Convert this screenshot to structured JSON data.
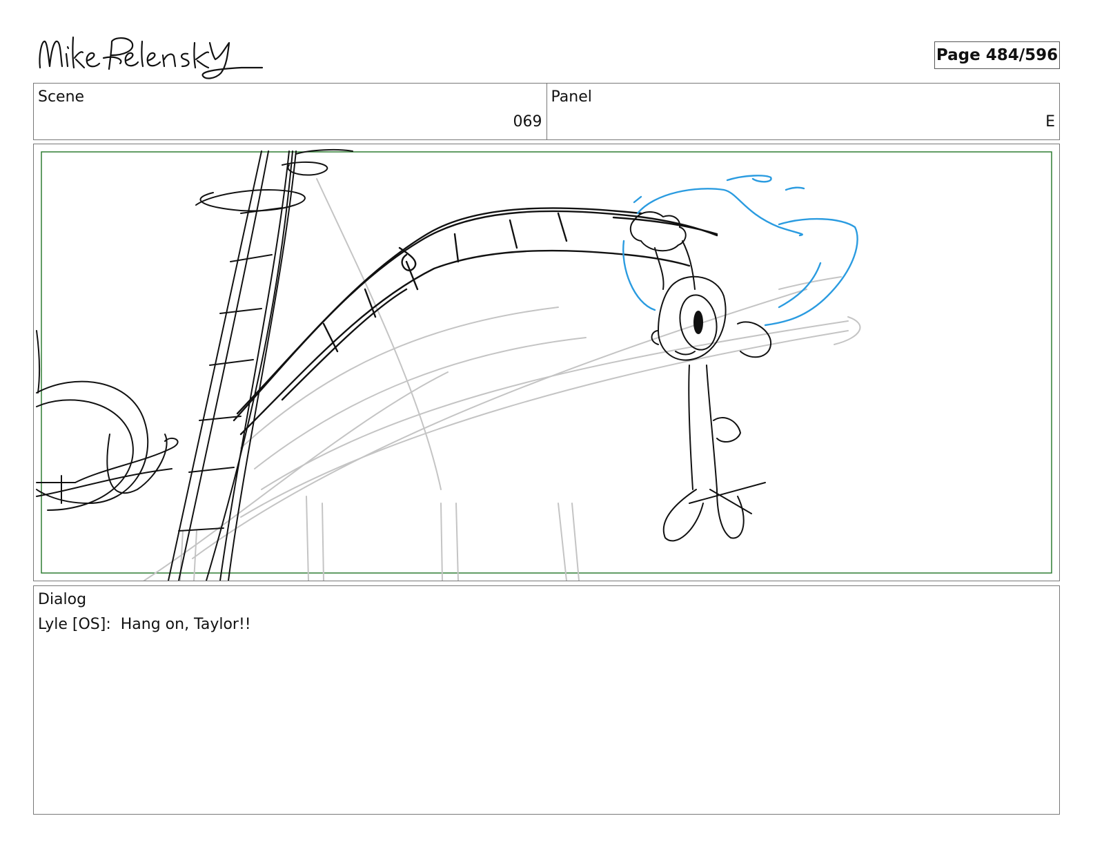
{
  "header": {
    "signature": "Mike Pelensky",
    "page_indicator": "Page 484/596"
  },
  "info": {
    "scene_label": "Scene",
    "scene_value": "069",
    "panel_label": "Panel",
    "panel_value": "E"
  },
  "dialog": {
    "label": "Dialog",
    "text": "Lyle [OS]:  Hang on, Taylor!!"
  },
  "colors": {
    "safe_frame": "#2e7d32",
    "sketch_ink": "#111111",
    "rough_gray": "#c4c4c4",
    "blue_pencil": "#2a9be0"
  }
}
